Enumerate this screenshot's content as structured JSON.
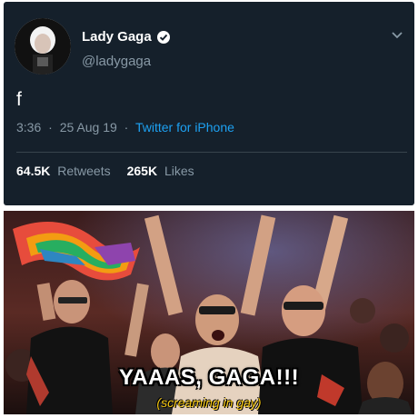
{
  "tweet": {
    "display_name": "Lady Gaga",
    "handle": "@ladygaga",
    "text": "f",
    "time": "3:36",
    "date": "25 Aug 19",
    "source": "Twitter for iPhone",
    "retweets_count": "64.5K",
    "retweets_label": "Retweets",
    "likes_count": "265K",
    "likes_label": "Likes",
    "icons": {
      "verified": "verified-badge-icon",
      "menu": "chevron-down-icon"
    },
    "colors": {
      "background": "#15202b",
      "link": "#1da1f2",
      "muted": "#8899a6"
    }
  },
  "meme": {
    "caption": "YAAAS, GAGA!!!",
    "subcaption": "(screaming in gay)",
    "colors": {
      "caption": "#ffffff",
      "subcaption": "#f1c40f"
    }
  }
}
